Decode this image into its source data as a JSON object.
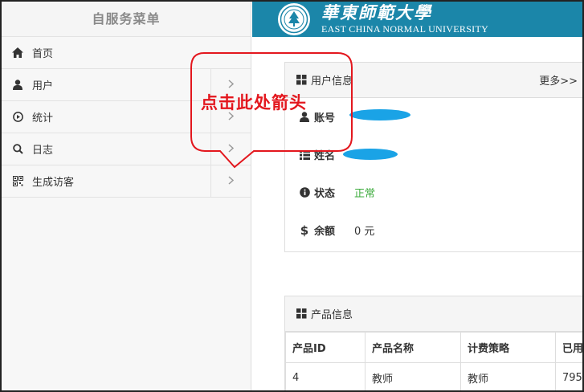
{
  "sidebar": {
    "title": "自服务菜单",
    "items": [
      {
        "label": "首页",
        "icon": "home-icon",
        "has_arrow": false
      },
      {
        "label": "用户",
        "icon": "user-icon",
        "has_arrow": true
      },
      {
        "label": "统计",
        "icon": "play-circle-icon",
        "has_arrow": true
      },
      {
        "label": "日志",
        "icon": "search-icon",
        "has_arrow": true
      },
      {
        "label": "生成访客",
        "icon": "qrcode-icon",
        "has_arrow": true
      }
    ]
  },
  "banner": {
    "cn": "華東師範大學",
    "en": "EAST CHINA NORMAL UNIVERSITY",
    "color": "#1b86a9"
  },
  "user_panel": {
    "title": "用户信息",
    "more": "更多>>",
    "rows": [
      {
        "label": "账号",
        "value": "",
        "icon": "user-icon"
      },
      {
        "label": "姓名",
        "value": "",
        "icon": "list-icon"
      },
      {
        "label": "状态",
        "value": "正常",
        "icon": "info-circle-icon"
      },
      {
        "label": "余额",
        "value": "0 元",
        "icon": "dollar-icon"
      }
    ]
  },
  "product_panel": {
    "title": "产品信息",
    "columns": [
      "产品ID",
      "产品名称",
      "计费策略",
      "已用"
    ],
    "rows": [
      [
        "4",
        "教师",
        "教师",
        "795"
      ]
    ]
  },
  "annotation": {
    "text": "点击此处箭头",
    "color": "#e3171e"
  }
}
